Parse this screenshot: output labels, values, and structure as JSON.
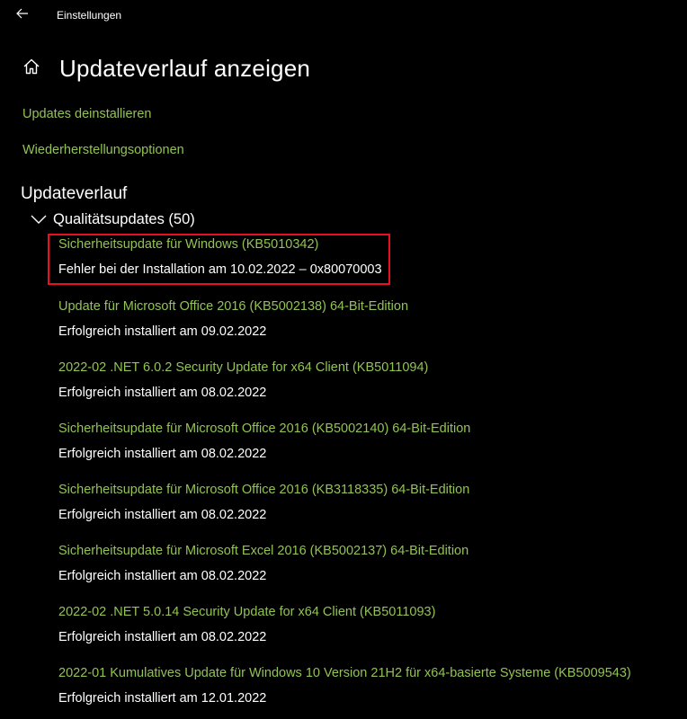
{
  "window": {
    "title": "Einstellungen"
  },
  "header": {
    "title": "Updateverlauf anzeigen"
  },
  "links": {
    "uninstall": "Updates deinstallieren",
    "recovery": "Wiederherstellungsoptionen"
  },
  "history": {
    "section_title": "Updateverlauf",
    "group_label": "Qualitätsupdates (50)",
    "items": [
      {
        "name": "Sicherheitsupdate für Windows (KB5010342)",
        "status": "Fehler bei der Installation am 10.02.2022 – 0x80070003"
      },
      {
        "name": "Update für Microsoft Office 2016 (KB5002138) 64-Bit-Edition",
        "status": "Erfolgreich installiert am 09.02.2022"
      },
      {
        "name": "2022-02 .NET 6.0.2 Security Update for x64 Client (KB5011094)",
        "status": "Erfolgreich installiert am 08.02.2022"
      },
      {
        "name": "Sicherheitsupdate für Microsoft Office 2016 (KB5002140) 64-Bit-Edition",
        "status": "Erfolgreich installiert am 08.02.2022"
      },
      {
        "name": "Sicherheitsupdate für Microsoft Office 2016 (KB3118335) 64-Bit-Edition",
        "status": "Erfolgreich installiert am 08.02.2022"
      },
      {
        "name": "Sicherheitsupdate für Microsoft Excel 2016 (KB5002137) 64-Bit-Edition",
        "status": "Erfolgreich installiert am 08.02.2022"
      },
      {
        "name": "2022-02 .NET 5.0.14 Security Update for x64 Client (KB5011093)",
        "status": "Erfolgreich installiert am 08.02.2022"
      },
      {
        "name": "2022-01 Kumulatives Update für Windows 10 Version 21H2 für x64-basierte Systeme (KB5009543)",
        "status": "Erfolgreich installiert am 12.01.2022"
      }
    ]
  },
  "icons": {
    "back": "back-arrow-icon",
    "home": "home-icon",
    "group": "chevron-down-icon"
  },
  "colors": {
    "background": "#000000",
    "link": "#92c353",
    "text": "#ffffff",
    "highlight": "#e81123"
  }
}
